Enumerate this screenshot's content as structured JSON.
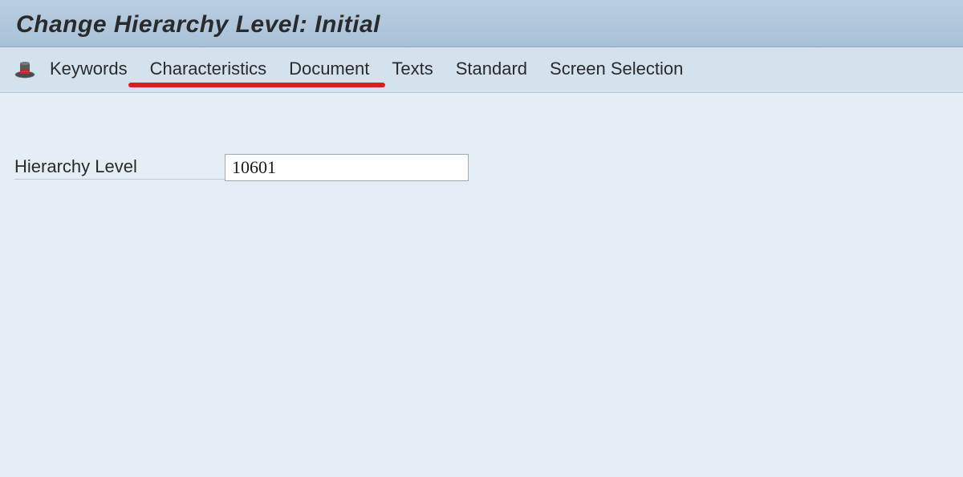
{
  "header": {
    "title": "Change Hierarchy Level: Initial"
  },
  "toolbar": {
    "icon": "hat-icon",
    "items": [
      {
        "label": "Keywords"
      },
      {
        "label": "Characteristics"
      },
      {
        "label": "Document"
      },
      {
        "label": "Texts"
      },
      {
        "label": "Standard"
      },
      {
        "label": "Screen Selection"
      }
    ]
  },
  "form": {
    "hierarchy_level": {
      "label": "Hierarchy Level",
      "value": "10601"
    }
  }
}
